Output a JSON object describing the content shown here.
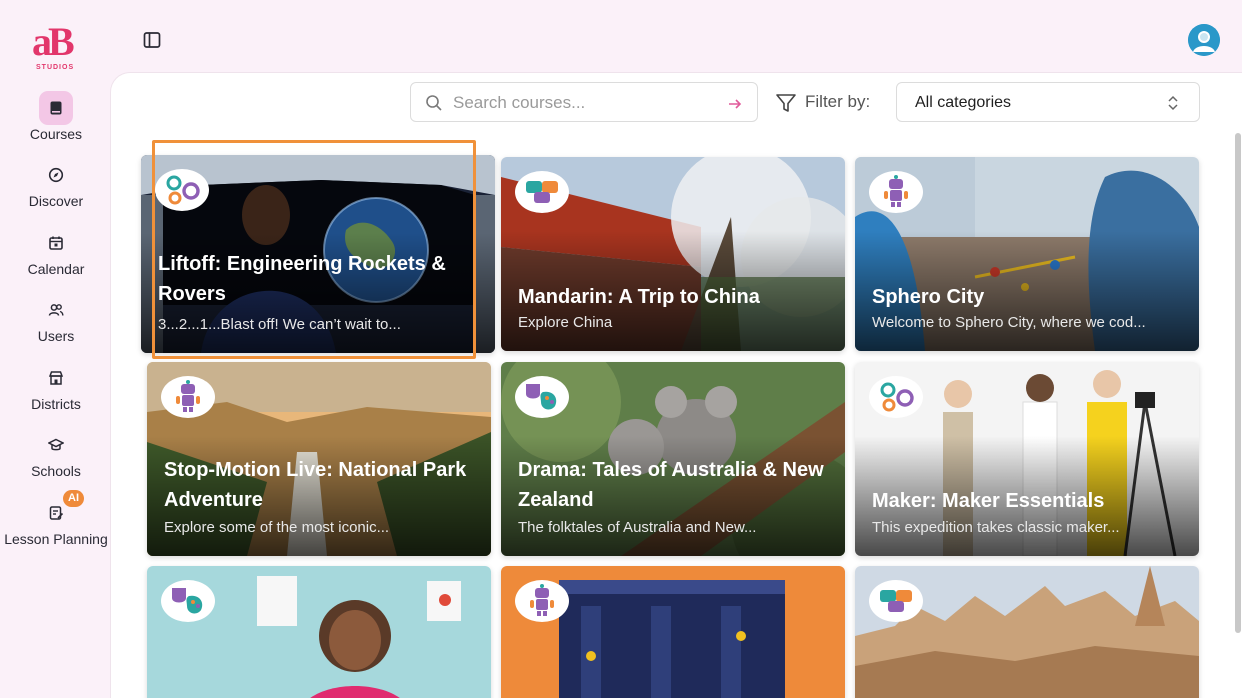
{
  "brand": {
    "letters": "aB",
    "sub": "STUDIOS",
    "color": "#e2366b"
  },
  "nav": [
    {
      "key": "courses",
      "label": "Courses",
      "icon": "book-icon",
      "active": true
    },
    {
      "key": "discover",
      "label": "Discover",
      "icon": "compass-icon"
    },
    {
      "key": "calendar",
      "label": "Calendar",
      "icon": "calendar-icon"
    },
    {
      "key": "users",
      "label": "Users",
      "icon": "users-icon"
    },
    {
      "key": "districts",
      "label": "Districts",
      "icon": "building-icon"
    },
    {
      "key": "schools",
      "label": "Schools",
      "icon": "graduation-cap-icon"
    },
    {
      "key": "lesson",
      "label": "Lesson Planning",
      "icon": "document-edit-icon",
      "badge": "AI"
    }
  ],
  "search": {
    "placeholder": "Search courses..."
  },
  "filter": {
    "label": "Filter by:",
    "selected": "All categories"
  },
  "accent": "#f0913a",
  "courses": [
    {
      "title": "Liftoff: Engineering Rockets & Rovers",
      "desc": "3...2...1...Blast off! We can’t wait to...",
      "category_icon": "gears-icon"
    },
    {
      "title": "Mandarin: A Trip to China",
      "desc": "Explore China",
      "category_icon": "chat-bubbles-icon"
    },
    {
      "title": "Sphero City",
      "desc": "Welcome to Sphero City, where we cod...",
      "category_icon": "robot-icon"
    },
    {
      "title": "Stop-Motion Live: National Park Adventure",
      "desc": "Explore some of the most iconic...",
      "category_icon": "robot-icon"
    },
    {
      "title": "Drama: Tales of Australia & New Zealand",
      "desc": "The folktales of Australia and New...",
      "category_icon": "theater-palette-icon"
    },
    {
      "title": "Maker: Maker Essentials",
      "desc": "This expedition takes classic maker...",
      "category_icon": "gears-icon"
    },
    {
      "title": "",
      "desc": "",
      "category_icon": "theater-palette-icon"
    },
    {
      "title": "",
      "desc": "",
      "category_icon": "robot-icon"
    },
    {
      "title": "",
      "desc": "",
      "category_icon": "chat-bubbles-icon"
    }
  ]
}
